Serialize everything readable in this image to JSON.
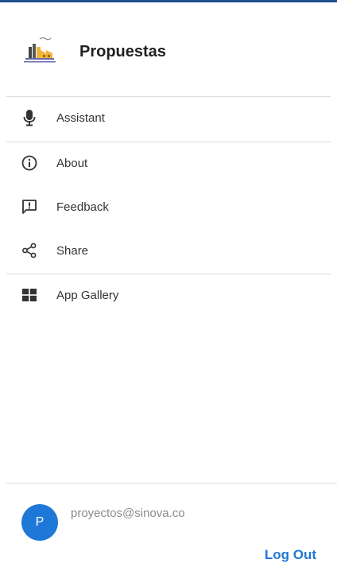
{
  "app": {
    "title": "Propuestas",
    "logo_icon": "factory-icon"
  },
  "menu": {
    "group1": [
      {
        "label": "Assistant",
        "icon": "microphone-icon"
      }
    ],
    "group2": [
      {
        "label": "About",
        "icon": "info-icon"
      },
      {
        "label": "Feedback",
        "icon": "feedback-icon"
      },
      {
        "label": "Share",
        "icon": "share-icon"
      }
    ],
    "group3": [
      {
        "label": "App Gallery",
        "icon": "app-gallery-icon"
      }
    ]
  },
  "user": {
    "avatar_initial": "P",
    "email": "proyectos@sinova.co"
  },
  "footer": {
    "logout_label": "Log Out"
  },
  "colors": {
    "accent": "#1e78d7",
    "top_border": "#1f4e8c",
    "icon": "#333333"
  }
}
